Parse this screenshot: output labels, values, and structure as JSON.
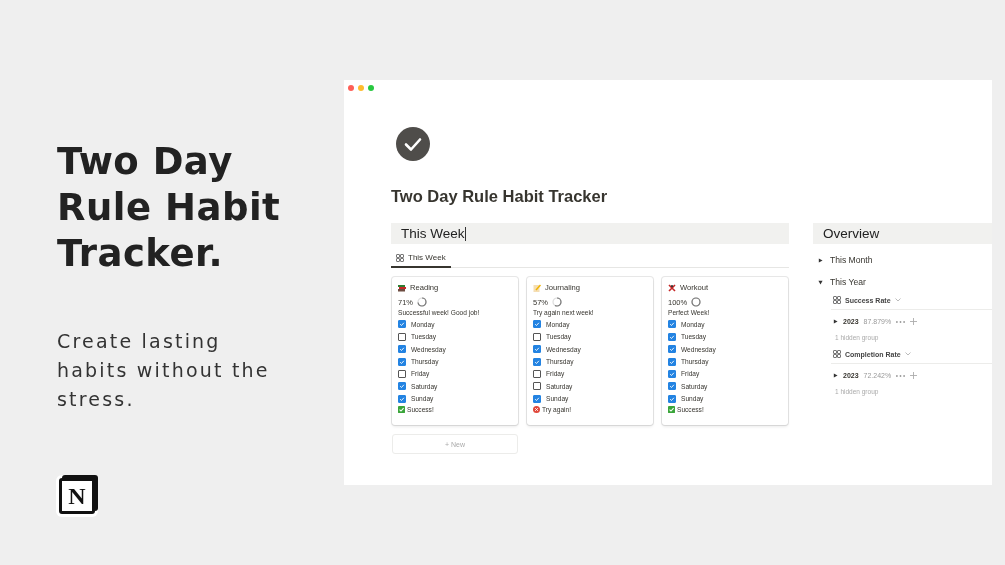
{
  "promo": {
    "heading": [
      "Two Day",
      "Rule Habit",
      "Tracker."
    ],
    "subtitle": [
      "Create lasting",
      "habits without the",
      "stress."
    ],
    "logo_letter": "N"
  },
  "page": {
    "title": "Two Day Rule Habit Tracker"
  },
  "this_week": {
    "heading": "This Week",
    "view_tab": {
      "label": "This Week",
      "selected": true
    },
    "cards": [
      {
        "name": "Reading",
        "percent": "71%",
        "message": "Successful week! Good job!",
        "days": [
          {
            "label": "Monday",
            "checked": true
          },
          {
            "label": "Tuesday",
            "checked": false
          },
          {
            "label": "Wednesday",
            "checked": true
          },
          {
            "label": "Thursday",
            "checked": true
          },
          {
            "label": "Friday",
            "checked": false
          },
          {
            "label": "Saturday",
            "checked": true
          },
          {
            "label": "Sunday",
            "checked": true
          }
        ],
        "result": {
          "label": "Success!",
          "kind": "success"
        }
      },
      {
        "name": "Journaling",
        "percent": "57%",
        "message": "Try again next week!",
        "days": [
          {
            "label": "Monday",
            "checked": true
          },
          {
            "label": "Tuesday",
            "checked": false
          },
          {
            "label": "Wednesday",
            "checked": true
          },
          {
            "label": "Thursday",
            "checked": true
          },
          {
            "label": "Friday",
            "checked": false
          },
          {
            "label": "Saturday",
            "checked": false
          },
          {
            "label": "Sunday",
            "checked": true
          }
        ],
        "result": {
          "label": "Try again!",
          "kind": "fail"
        }
      },
      {
        "name": "Workout",
        "percent": "100%",
        "message": "Perfect Week!",
        "days": [
          {
            "label": "Monday",
            "checked": true
          },
          {
            "label": "Tuesday",
            "checked": true
          },
          {
            "label": "Wednesday",
            "checked": true
          },
          {
            "label": "Thursday",
            "checked": true
          },
          {
            "label": "Friday",
            "checked": true
          },
          {
            "label": "Saturday",
            "checked": true
          },
          {
            "label": "Sunday",
            "checked": true
          }
        ],
        "result": {
          "label": "Success!",
          "kind": "success"
        }
      }
    ],
    "new_button": "+ New"
  },
  "overview": {
    "heading": "Overview",
    "sections": [
      {
        "label": "This Month",
        "expanded": false
      },
      {
        "label": "This Year",
        "expanded": true,
        "views": [
          {
            "label": "Success Rate",
            "group": "2023",
            "value": "87.879%",
            "hidden": "1 hidden group"
          },
          {
            "label": "Completion Rate",
            "group": "2023",
            "value": "72.242%",
            "hidden": "1 hidden group"
          }
        ]
      }
    ]
  }
}
